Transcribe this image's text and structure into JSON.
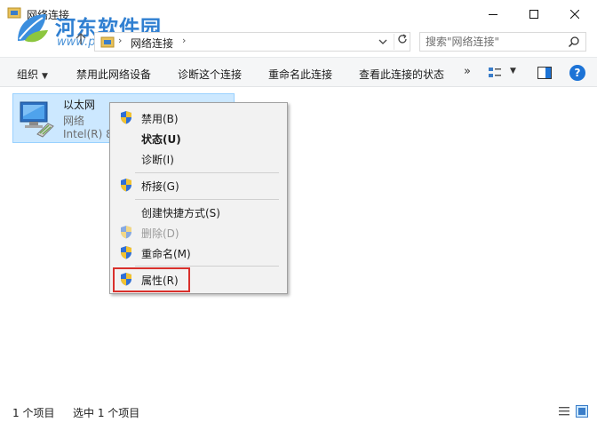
{
  "window": {
    "title": "网络连接",
    "watermark_name": "河东软件园",
    "watermark_url": "www.pc0359.cn"
  },
  "address_bar": {
    "breadcrumb": "网络连接",
    "separator": "›",
    "refresh_icon": "refresh-icon"
  },
  "search": {
    "placeholder": "搜索\"网络连接\""
  },
  "command_bar": {
    "organize": "组织",
    "disable_device": "禁用此网络设备",
    "diagnose": "诊断这个连接",
    "rename": "重命名此连接",
    "view_status": "查看此连接的状态",
    "more": "»",
    "help": "?"
  },
  "item": {
    "name": "以太网",
    "subtitle": "网络",
    "device": "Intel(R) 8"
  },
  "context_menu": {
    "items": [
      {
        "label": "禁用(B)",
        "icon": "shield-icon"
      },
      {
        "label": "状态(U)",
        "icon": ""
      },
      {
        "label": "诊断(I)",
        "icon": ""
      },
      {
        "label": "桥接(G)",
        "icon": "shield-icon"
      },
      {
        "label": "创建快捷方式(S)",
        "icon": ""
      },
      {
        "label": "删除(D)",
        "icon": "shield-icon"
      },
      {
        "label": "重命名(M)",
        "icon": "shield-icon"
      },
      {
        "label": "属性(R)",
        "icon": "shield-icon"
      }
    ]
  },
  "status_bar": {
    "item_count": "1 个项目",
    "selected": "选中 1 个项目"
  },
  "colors": {
    "selection_bg": "#cce8ff",
    "highlight_border": "#d9302c",
    "accent": "#1c73d6"
  }
}
